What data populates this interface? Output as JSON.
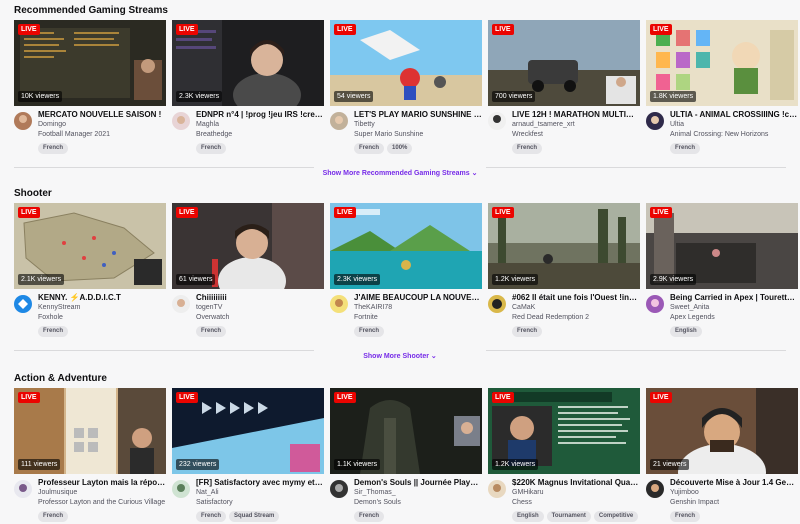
{
  "colors": {
    "live": "#eb0400",
    "accent": "#772ce8"
  },
  "sections": [
    {
      "title": "Recommended Gaming Streams",
      "show_more": "Show More Recommended Gaming Streams",
      "cards": [
        {
          "live": "LIVE",
          "viewers": "10K viewers",
          "title": "MERCATO NOUVELLE SAISON !",
          "channel": "Domingo",
          "game": "Football Manager 2021",
          "tags": [
            "French"
          ]
        },
        {
          "live": "LIVE",
          "viewers": "2.3K viewers",
          "title": "EDNPR n°4 | !prog !jeu IRS !createur !...",
          "channel": "Maghla",
          "game": "Breathedge",
          "tags": [
            "French"
          ]
        },
        {
          "live": "LIVE",
          "viewers": "54 viewers",
          "title": "LET'S PLAY MARIO SUNSHINE - je re...",
          "channel": "Tibetty",
          "game": "Super Mario Sunshine",
          "tags": [
            "French",
            "100%"
          ]
        },
        {
          "live": "LIVE",
          "viewers": "700 viewers",
          "title": "LIVE 12H ! MARATHON MULTIGAMIN...",
          "channel": "arnaud_tsamere_xrt",
          "game": "Wreckfest",
          "tags": [
            "French"
          ]
        },
        {
          "live": "LIVE",
          "viewers": "1.8K viewers",
          "title": "ULTIA - ANIMAL CROSSIIING !code !y...",
          "channel": "Ultia",
          "game": "Animal Crossing: New Horizons",
          "tags": [
            "French"
          ]
        }
      ]
    },
    {
      "title": "Shooter",
      "show_more": "Show More Shooter",
      "cards": [
        {
          "live": "LIVE",
          "viewers": "2.1K viewers",
          "title": "KENNY. ⚡A.D.D.I.C.T",
          "channel": "KennyStream",
          "game": "Foxhole",
          "tags": [
            "French"
          ]
        },
        {
          "live": "LIVE",
          "viewers": "61 viewers",
          "title": "Chiiiiiiiii",
          "channel": "togenTV",
          "game": "Overwatch",
          "tags": [
            "French"
          ]
        },
        {
          "live": "LIVE",
          "viewers": "2.3K viewers",
          "title": "J'AIME BEAUCOUP LA NOUVELLE SA...",
          "channel": "TheKAIRI78",
          "game": "Fortnite",
          "tags": [
            "French"
          ]
        },
        {
          "live": "LIVE",
          "viewers": "1.2K viewers",
          "title": "#062 Il était une fois l'Ouest !insta !s...",
          "channel": "CaMaK",
          "game": "Red Dead Redemption 2",
          "tags": [
            "French"
          ]
        },
        {
          "live": "LIVE",
          "viewers": "2.9K viewers",
          "title": "Being Carried in Apex | Tourette's Sy...",
          "channel": "Sweet_Anita",
          "game": "Apex Legends",
          "tags": [
            "English"
          ]
        }
      ]
    },
    {
      "title": "Action & Adventure",
      "cards": [
        {
          "live": "LIVE",
          "viewers": "111 viewers",
          "title": "Professeur Layton mais la réponse e...",
          "channel": "Joulmusique",
          "game": "Professor Layton and the Curious Village",
          "tags": [
            "French"
          ]
        },
        {
          "live": "LIVE",
          "viewers": "232 viewers",
          "title": "[FR] Satisfactory avec mymy et shishi",
          "channel": "Nat_Ali",
          "game": "Satisfactory",
          "tags": [
            "French",
            "Squad Stream"
          ]
        },
        {
          "live": "LIVE",
          "viewers": "1.1K viewers",
          "title": "Demon's Souls || Journée PlayStatio...",
          "channel": "Sir_Thomas_",
          "game": "Demon's Souls",
          "tags": [
            "French"
          ]
        },
        {
          "live": "LIVE",
          "viewers": "1.2K viewers",
          "title": "$220K Magnus Invitational Quarterfi...",
          "channel": "GMHikaru",
          "game": "Chess",
          "tags": [
            "English",
            "Tournament",
            "Competitive"
          ]
        },
        {
          "live": "LIVE",
          "viewers": "21 viewers",
          "title": "Découverte Mise à Jour 1.4 Genshin !",
          "channel": "Yujimboo",
          "game": "Genshin Impact",
          "tags": [
            "French"
          ]
        }
      ]
    }
  ]
}
